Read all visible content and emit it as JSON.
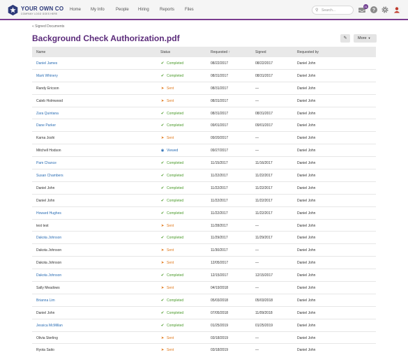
{
  "app": {
    "brand": "YOUR OWN CO",
    "tagline": "COMPANY LOGO GOES HERE",
    "nav": [
      "Home",
      "My Info",
      "People",
      "Hiring",
      "Reports",
      "Files"
    ],
    "search_placeholder": "Search...",
    "inbox_count": "31"
  },
  "page": {
    "breadcrumb": "« Signed Documents",
    "title": "Background Check Authorization.pdf",
    "more_label": "More"
  },
  "table": {
    "headers": {
      "name": "Name",
      "status": "Status",
      "requested": "Requested ↑",
      "signed": "Signed",
      "requested_by": "Requested by"
    },
    "rows": [
      {
        "name": "Daniel James",
        "link": true,
        "status": "Completed",
        "requested": "08/22/2017",
        "signed": "08/22/2017",
        "by": "Daniel John"
      },
      {
        "name": "Mark Whinery",
        "link": true,
        "status": "Completed",
        "requested": "08/31/2017",
        "signed": "08/31/2017",
        "by": "Daniel John"
      },
      {
        "name": "Randy Ericson",
        "link": false,
        "status": "Sent",
        "requested": "08/31/2017",
        "signed": "—",
        "by": "Daniel John"
      },
      {
        "name": "Caleb Holmwood",
        "link": false,
        "status": "Sent",
        "requested": "08/31/2017",
        "signed": "—",
        "by": "Daniel John"
      },
      {
        "name": "Zara Quintana",
        "link": true,
        "status": "Completed",
        "requested": "08/31/2017",
        "signed": "08/31/2017",
        "by": "Daniel John"
      },
      {
        "name": "Dane Parker",
        "link": true,
        "status": "Completed",
        "requested": "09/01/2017",
        "signed": "09/01/2017",
        "by": "Daniel John"
      },
      {
        "name": "Karna Joshi",
        "link": false,
        "status": "Sent",
        "requested": "09/20/2017",
        "signed": "—",
        "by": "Daniel John"
      },
      {
        "name": "Mitchell Hodson",
        "link": false,
        "status": "Viewed",
        "requested": "09/27/2017",
        "signed": "—",
        "by": "Daniel John"
      },
      {
        "name": "Pam Chance",
        "link": true,
        "status": "Completed",
        "requested": "11/15/2017",
        "signed": "11/16/2017",
        "by": "Daniel John"
      },
      {
        "name": "Susan Chambers",
        "link": true,
        "status": "Completed",
        "requested": "11/22/2017",
        "signed": "11/22/2017",
        "by": "Daniel John"
      },
      {
        "name": "Daniel John",
        "link": false,
        "status": "Completed",
        "requested": "11/22/2017",
        "signed": "11/22/2017",
        "by": "Daniel John"
      },
      {
        "name": "Daniel John",
        "link": false,
        "status": "Completed",
        "requested": "11/22/2017",
        "signed": "11/22/2017",
        "by": "Daniel John"
      },
      {
        "name": "Howard Hughes",
        "link": true,
        "status": "Completed",
        "requested": "11/22/2017",
        "signed": "11/22/2017",
        "by": "Daniel John"
      },
      {
        "name": "test test",
        "link": false,
        "status": "Sent",
        "requested": "11/28/2017",
        "signed": "—",
        "by": "Daniel John"
      },
      {
        "name": "Dakota Johnson",
        "link": true,
        "status": "Completed",
        "requested": "11/29/2017",
        "signed": "11/29/2017",
        "by": "Daniel John"
      },
      {
        "name": "Dakota Johnson",
        "link": false,
        "status": "Sent",
        "requested": "11/30/2017",
        "signed": "—",
        "by": "Daniel John"
      },
      {
        "name": "Dakota Johnson",
        "link": false,
        "status": "Sent",
        "requested": "12/05/2017",
        "signed": "—",
        "by": "Daniel John"
      },
      {
        "name": "Dakota Johnson",
        "link": true,
        "status": "Completed",
        "requested": "12/15/2017",
        "signed": "12/15/2017",
        "by": "Daniel John"
      },
      {
        "name": "Sally Meadows",
        "link": false,
        "status": "Sent",
        "requested": "04/19/2018",
        "signed": "—",
        "by": "Daniel John"
      },
      {
        "name": "Brianna Lim",
        "link": true,
        "status": "Completed",
        "requested": "05/03/2018",
        "signed": "05/03/2018",
        "by": "Daniel John"
      },
      {
        "name": "Daniel John",
        "link": false,
        "status": "Completed",
        "requested": "07/05/2018",
        "signed": "11/09/2018",
        "by": "Daniel John"
      },
      {
        "name": "Jessica McMillan",
        "link": true,
        "status": "Completed",
        "requested": "01/25/2019",
        "signed": "01/25/2019",
        "by": "Daniel John"
      },
      {
        "name": "Olivia Sterling",
        "link": false,
        "status": "Sent",
        "requested": "03/18/2019",
        "signed": "—",
        "by": "Daniel John"
      },
      {
        "name": "Ryota Saito",
        "link": false,
        "status": "Sent",
        "requested": "03/18/2019",
        "signed": "—",
        "by": "Daniel John"
      }
    ]
  },
  "status_styles": {
    "Completed": {
      "icon": "check-circle-icon",
      "color": "#4a9a2a"
    },
    "Sent": {
      "icon": "paper-plane-icon",
      "color": "#e07a1e"
    },
    "Viewed": {
      "icon": "eye-icon",
      "color": "#2a6db4"
    }
  }
}
